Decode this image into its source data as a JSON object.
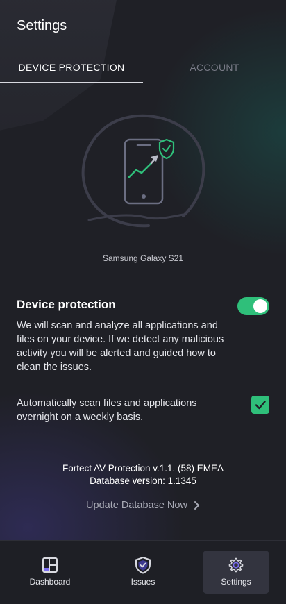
{
  "header": {
    "title": "Settings"
  },
  "tabs": [
    {
      "label": "DEVICE PROTECTION",
      "active": true
    },
    {
      "label": "ACCOUNT",
      "active": false
    }
  ],
  "device": {
    "name": "Samsung Galaxy S21"
  },
  "protection": {
    "title": "Device protection",
    "enabled": true,
    "description": "We will scan and analyze all applications and files on your device. If we detect any malicious activity you will be alerted and guided how to clean the issues."
  },
  "auto_scan": {
    "label": "Automatically scan files and applications overnight on a weekly basis.",
    "checked": true
  },
  "version": {
    "product": "Fortect AV Protection v.1.1. (58) EMEA",
    "database": "Database version: 1.1345"
  },
  "update": {
    "label": "Update Database Now"
  },
  "nav": [
    {
      "label": "Dashboard",
      "icon": "dashboard-icon"
    },
    {
      "label": "Issues",
      "icon": "shield-icon"
    },
    {
      "label": "Settings",
      "icon": "gear-icon",
      "active": true
    }
  ],
  "colors": {
    "accent": "#2fbf7a",
    "background": "#1f2026"
  }
}
